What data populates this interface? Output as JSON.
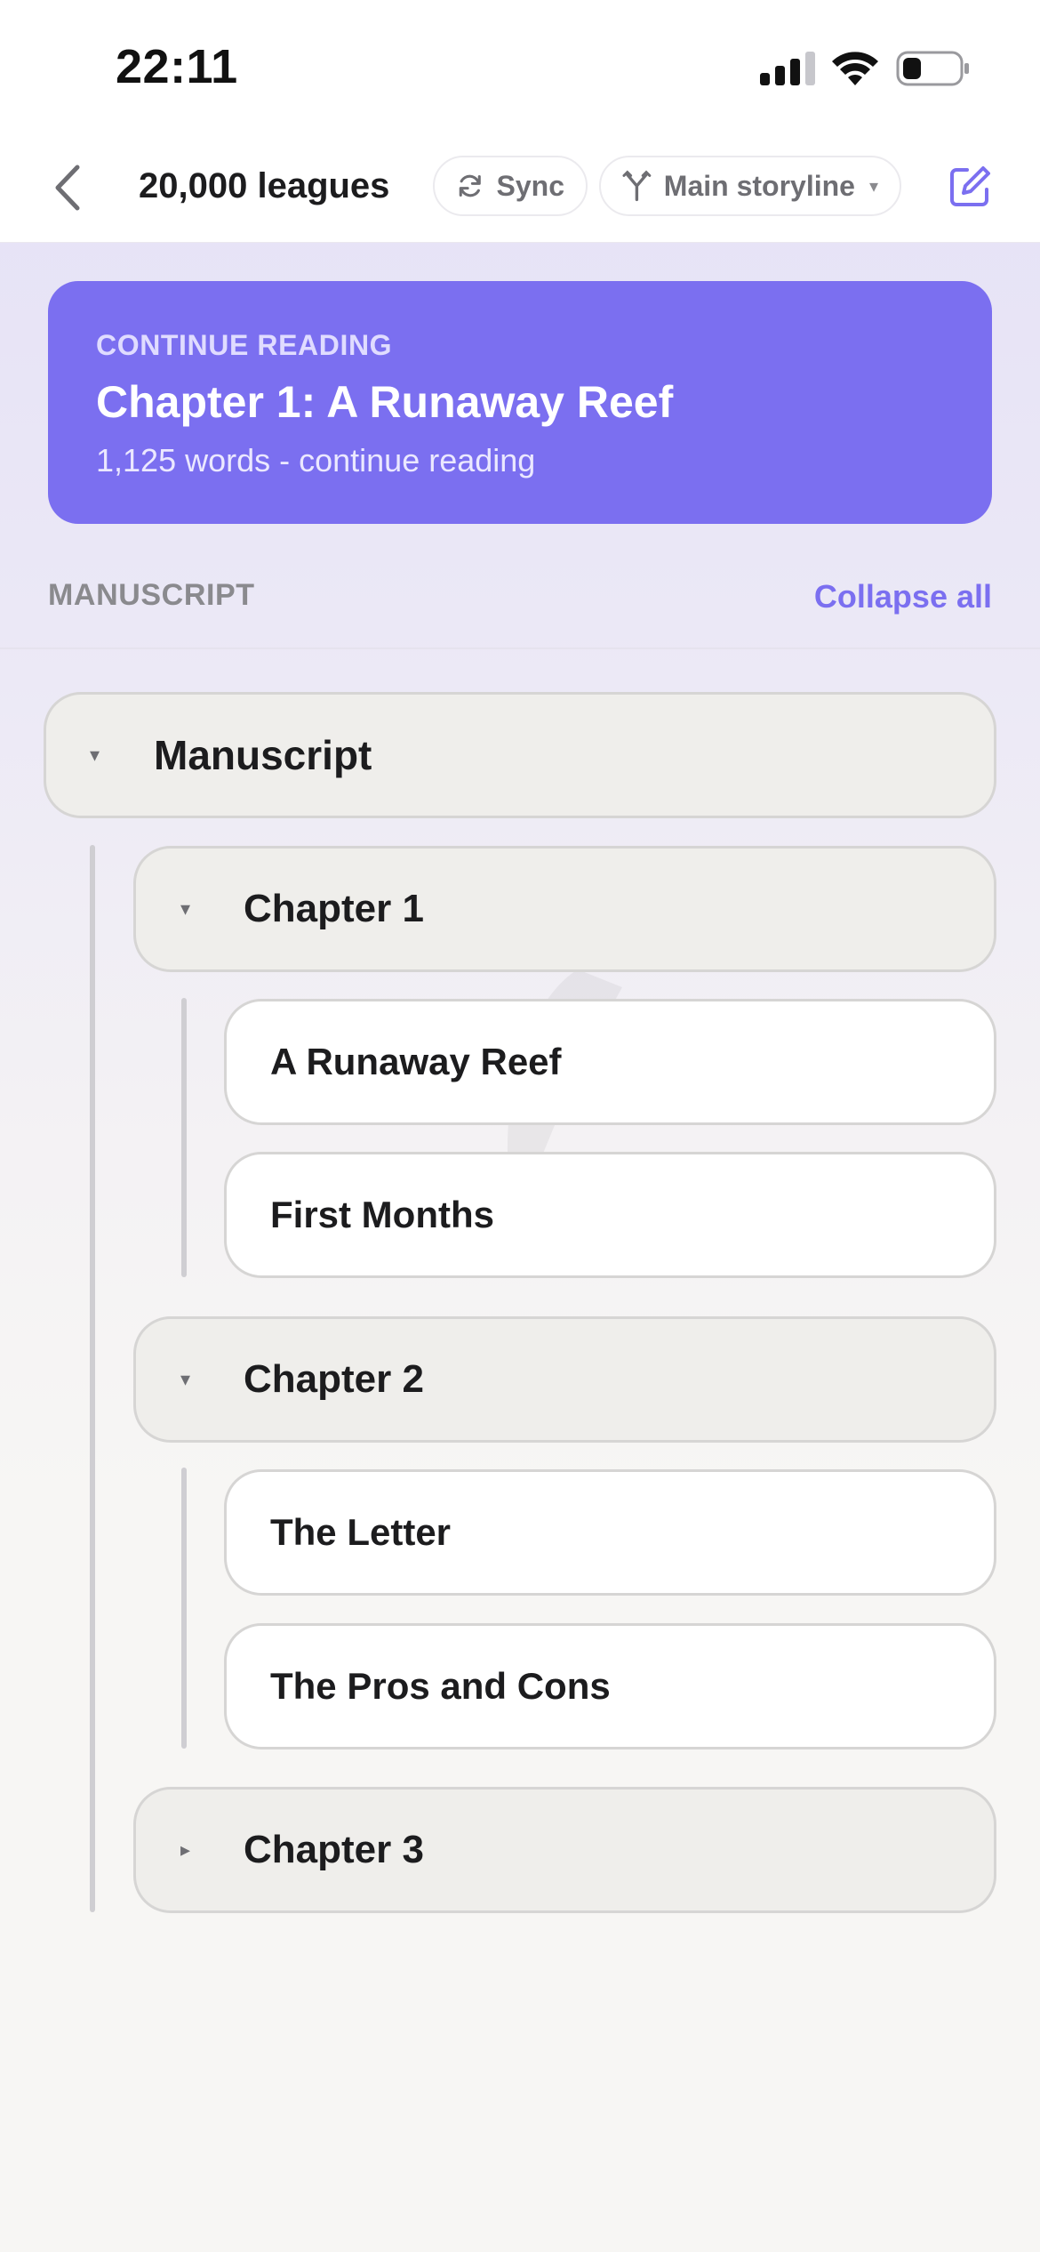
{
  "status_bar": {
    "time": "22:11",
    "icons": [
      "cellular-signal-icon",
      "wifi-icon",
      "battery-icon"
    ]
  },
  "nav": {
    "back_icon": "chevron-left-icon",
    "title": "20,000 leagues",
    "sync": {
      "icon": "sync-icon",
      "label": "Sync"
    },
    "storyline": {
      "icon": "branch-icon",
      "label": "Main storyline",
      "caret": "▾"
    },
    "edit_icon": "compose-icon"
  },
  "continue_reading": {
    "label": "CONTINUE READING",
    "title": "Chapter 1: A Runaway Reef",
    "subtitle": "1,125 words - continue reading"
  },
  "section": {
    "title": "MANUSCRIPT",
    "action": "Collapse all"
  },
  "tree": {
    "root": {
      "label": "Manuscript",
      "arrow": "▾"
    },
    "chapters": [
      {
        "label": "Chapter 1",
        "arrow": "▾",
        "scenes": [
          {
            "label": "A Runaway Reef"
          },
          {
            "label": "First Months"
          }
        ]
      },
      {
        "label": "Chapter 2",
        "arrow": "▾",
        "scenes": [
          {
            "label": "The Letter"
          },
          {
            "label": "The Pros and Cons"
          }
        ]
      },
      {
        "label": "Chapter 3",
        "arrow": "▸",
        "scenes": []
      }
    ]
  },
  "colors": {
    "accent": "#7b6ff0",
    "card_background": "#7b6ff0",
    "folder_row": "#efeeeb",
    "leaf_row": "#ffffff",
    "text": "#1c1c1e",
    "muted": "#8a8a8e"
  }
}
